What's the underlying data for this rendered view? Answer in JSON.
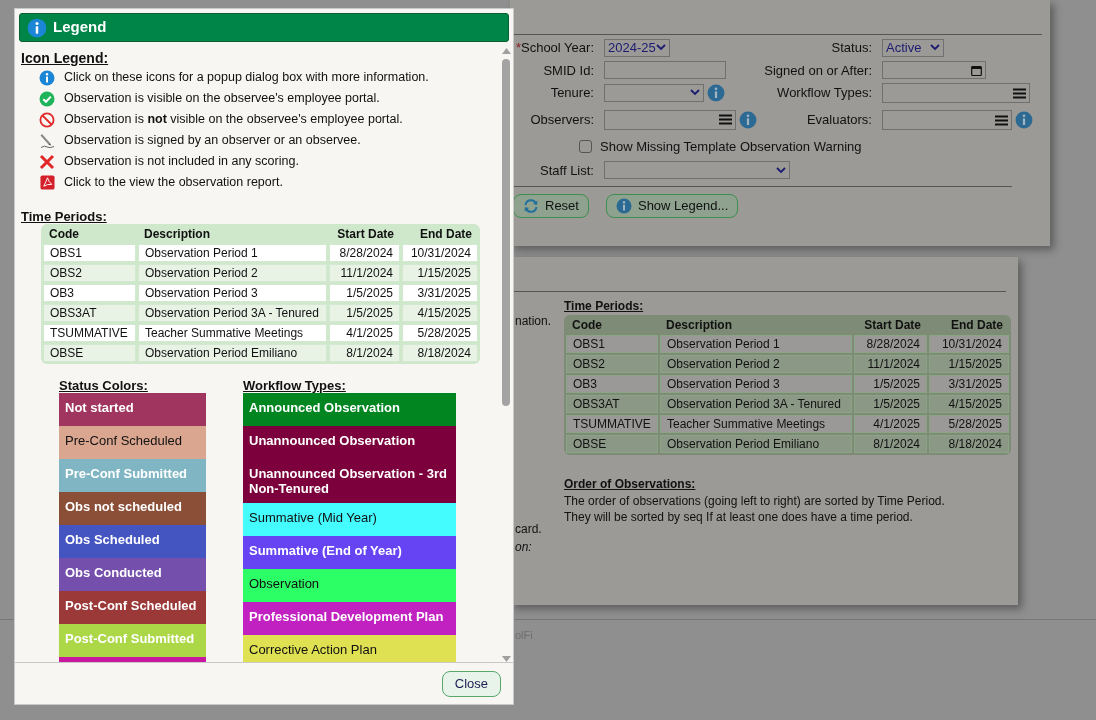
{
  "filters": {
    "left_fields": [
      {
        "label": "School Year:",
        "required_mark": "*",
        "kind": "select",
        "value": "2024-25",
        "info": false
      },
      {
        "label": "SMID Id:",
        "kind": "text",
        "info": false
      },
      {
        "label": "Tenure:",
        "kind": "select",
        "info": true
      },
      {
        "label": "Observers:",
        "kind": "multi",
        "info": true
      }
    ],
    "right_fields": [
      {
        "label": "Status:",
        "kind": "select",
        "value": "Active",
        "info": false
      },
      {
        "label": "Signed on or After:",
        "kind": "date",
        "info": false
      },
      {
        "label": "Workflow Types:",
        "kind": "multi",
        "info": false
      },
      {
        "label": "Evaluators:",
        "kind": "multi",
        "info": true
      }
    ],
    "checkbox": {
      "label": "Show Missing Template Observation Warning",
      "checked": false
    },
    "staff_list": {
      "label": "Staff List:",
      "kind": "select"
    },
    "buttons": [
      {
        "kind": "reset",
        "label": "Reset"
      },
      {
        "kind": "info",
        "label": "Show Legend..."
      }
    ]
  },
  "right_panel": {
    "cut_texts": [
      {
        "text": "nation.",
        "italic": false
      },
      {
        "text": "card.",
        "italic": false
      },
      {
        "text": "on:",
        "italic": true
      }
    ],
    "time_periods": {
      "heading": "Time Periods:",
      "columns": [
        "Code",
        "Description",
        "Start Date",
        "End Date"
      ],
      "rows": [
        [
          "OBS1",
          "Observation Period 1",
          "8/28/2024",
          "10/31/2024"
        ],
        [
          "OBS2",
          "Observation Period 2",
          "11/1/2024",
          "1/15/2025"
        ],
        [
          "OB3",
          "Observation Period 3",
          "1/5/2025",
          "3/31/2025"
        ],
        [
          "OBS3AT",
          "Observation Period 3A - Tenured",
          "1/5/2025",
          "4/15/2025"
        ],
        [
          "TSUMMATIVE",
          "Teacher Summative Meetings",
          "4/1/2025",
          "5/28/2025"
        ],
        [
          "OBSE",
          "Observation Period Emiliano",
          "8/1/2024",
          "8/18/2024"
        ]
      ]
    },
    "order": {
      "heading": "Order of Observations:",
      "lines": [
        "The order of observations (going left to right) are sorted by Time Period.",
        "They will be sorted by seq If at least one does have a time period."
      ]
    }
  },
  "footer": "olFi",
  "legend_dialog": {
    "title": "Legend",
    "icon_legend": {
      "heading": "Icon Legend:",
      "items": [
        {
          "kind": "info",
          "text": "Click on these icons for a popup dialog box with more information."
        },
        {
          "kind": "visible",
          "text": "Observation is visible on the observee's employee portal."
        },
        {
          "kind": "not-visible",
          "text": "Observation is **not** visible on the observee's employee portal."
        },
        {
          "kind": "signed",
          "text": "Observation is signed by an observer or an observee."
        },
        {
          "kind": "excluded",
          "text": "Observation is not included in any scoring."
        },
        {
          "kind": "report",
          "text": "Click to the view the observation report."
        }
      ]
    },
    "time_periods": {
      "heading": "Time Periods:",
      "columns": [
        "Code",
        "Description",
        "Start Date",
        "End Date"
      ],
      "rows": [
        [
          "OBS1",
          "Observation Period 1",
          "8/28/2024",
          "10/31/2024"
        ],
        [
          "OBS2",
          "Observation Period 2",
          "11/1/2024",
          "1/15/2025"
        ],
        [
          "OB3",
          "Observation Period 3",
          "1/5/2025",
          "3/31/2025"
        ],
        [
          "OBS3AT",
          "Observation Period 3A - Tenured",
          "1/5/2025",
          "4/15/2025"
        ],
        [
          "TSUMMATIVE",
          "Teacher Summative Meetings",
          "4/1/2025",
          "5/28/2025"
        ],
        [
          "OBSE",
          "Observation Period Emiliano",
          "8/1/2024",
          "8/18/2024"
        ]
      ]
    },
    "status_colors": {
      "heading": "Status Colors:",
      "items": [
        {
          "label": "Not started",
          "color": "#a0365f",
          "dark_label": false
        },
        {
          "label": "Pre-Conf Scheduled",
          "color": "#dba690",
          "dark_label": true
        },
        {
          "label": "Pre-Conf Submitted",
          "color": "#80b6c4",
          "dark_label": false
        },
        {
          "label": "Obs not scheduled",
          "color": "#8b4f38",
          "dark_label": false
        },
        {
          "label": "Obs Scheduled",
          "color": "#4455c1",
          "dark_label": false
        },
        {
          "label": "Obs Conducted",
          "color": "#744fab",
          "dark_label": false
        },
        {
          "label": "Post-Conf Scheduled",
          "color": "#9b3838",
          "dark_label": false
        },
        {
          "label": "Post-Conf Submitted",
          "color": "#acd848",
          "dark_label": false
        },
        {
          "color": "#c8189f"
        }
      ]
    },
    "workflow_types": {
      "heading": "Workflow Types:",
      "items": [
        {
          "label": "Announced Observation",
          "color": "#008520",
          "dark_label": false
        },
        {
          "label": "Unannounced Observation",
          "color": "#7c003c",
          "dark_label": false
        },
        {
          "label": "Unannounced Observation - 3rd Non-Tenured",
          "color": "#7c003c",
          "dark_label": false
        },
        {
          "label": "Summative (Mid Year)",
          "color": "#44fbfd",
          "dark_label": true
        },
        {
          "label": "Summative (End of Year)",
          "color": "#6644f4",
          "dark_label": false
        },
        {
          "label": "Observation",
          "color": "#2cfe66",
          "dark_label": true
        },
        {
          "label": "Professional Development Plan",
          "color": "#c021c0",
          "dark_label": false
        },
        {
          "label": "Corrective Action Plan",
          "color": "#dfe052",
          "dark_label": true
        }
      ]
    },
    "close_button": "Close"
  }
}
